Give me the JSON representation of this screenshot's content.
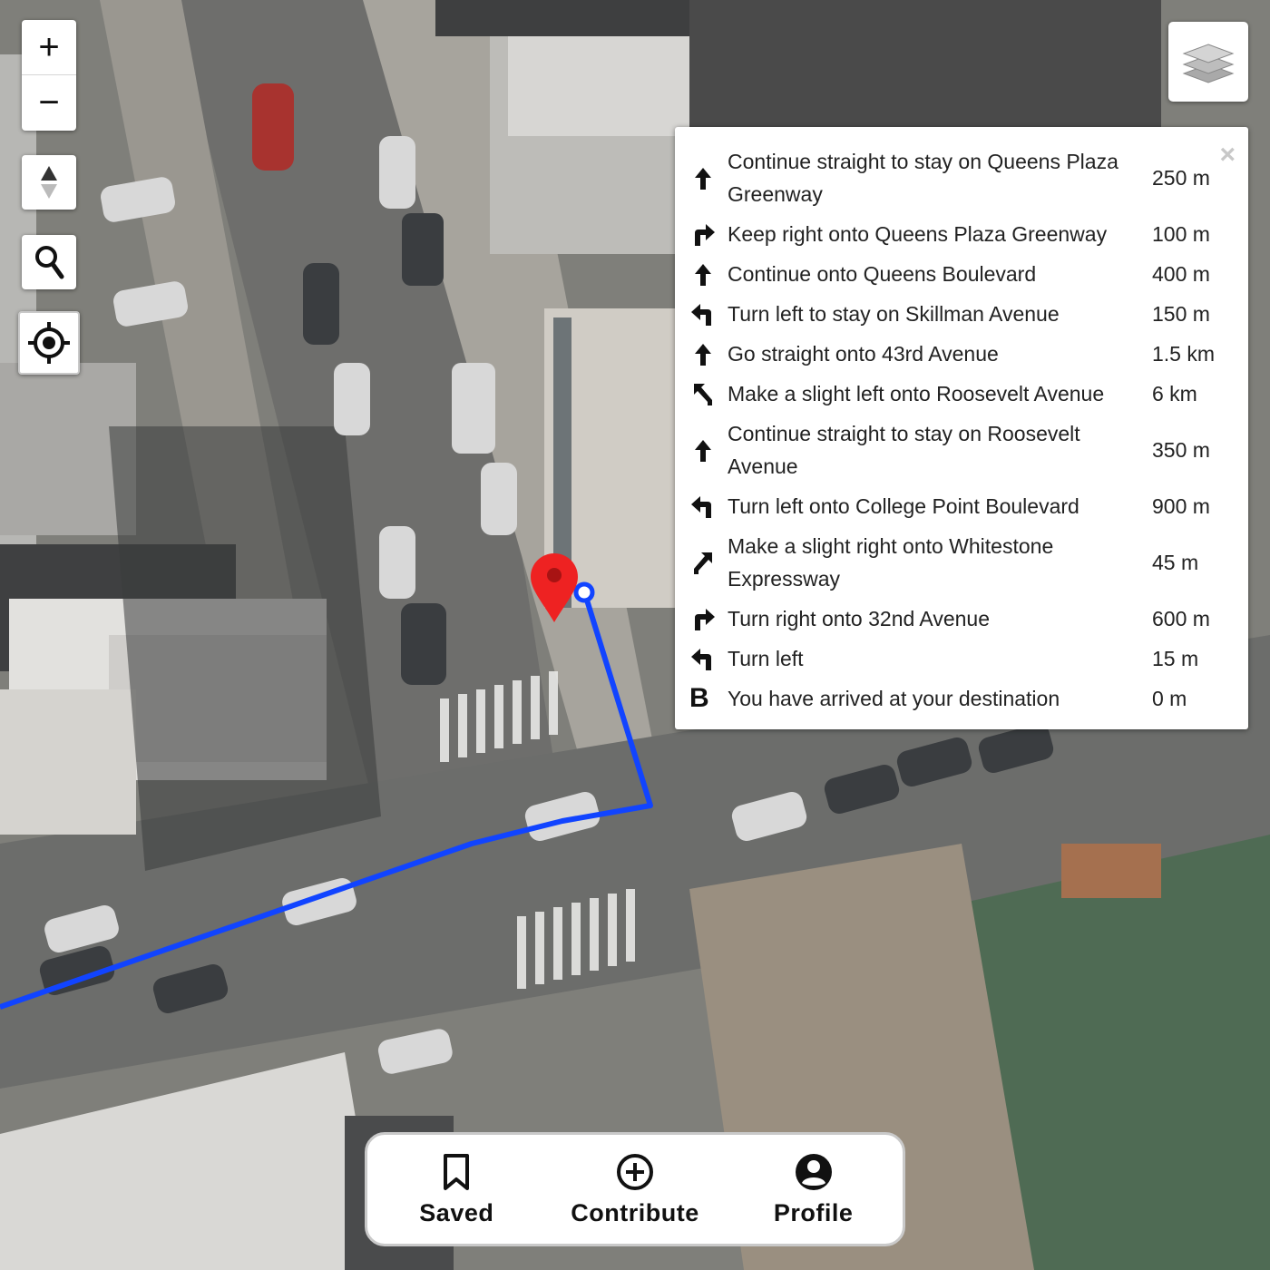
{
  "map": {
    "zoom_in_label": "+",
    "zoom_out_label": "−",
    "route_color": "#1144ff",
    "marker_color": "#ee2222"
  },
  "directions": {
    "close_label": "×",
    "steps": [
      {
        "icon": "straight-arrow-icon",
        "text": "Continue straight to stay on Queens Plaza Greenway",
        "distance": "250 m"
      },
      {
        "icon": "turn-right-icon",
        "text": "Keep right onto Queens Plaza Greenway",
        "distance": "100 m"
      },
      {
        "icon": "straight-arrow-icon",
        "text": "Continue onto Queens Boulevard",
        "distance": "400 m"
      },
      {
        "icon": "turn-left-icon",
        "text": "Turn left to stay on Skillman Avenue",
        "distance": "150 m"
      },
      {
        "icon": "straight-arrow-icon",
        "text": "Go straight onto 43rd Avenue",
        "distance": "1.5 km"
      },
      {
        "icon": "slight-left-icon",
        "text": "Make a slight left onto Roosevelt Avenue",
        "distance": "6 km"
      },
      {
        "icon": "straight-arrow-icon",
        "text": "Continue straight to stay on Roosevelt Avenue",
        "distance": "350 m"
      },
      {
        "icon": "turn-left-icon",
        "text": "Turn left onto College Point Boulevard",
        "distance": "900 m"
      },
      {
        "icon": "slight-right-icon",
        "text": "Make a slight right onto Whitestone Expressway",
        "distance": "45 m"
      },
      {
        "icon": "turn-right-icon",
        "text": "Turn right onto 32nd Avenue",
        "distance": "600 m"
      },
      {
        "icon": "turn-left-icon",
        "text": "Turn left",
        "distance": "15 m"
      },
      {
        "icon": "destination-b-icon",
        "text": "You have arrived at your destination",
        "distance": "0 m",
        "letter": "B"
      }
    ]
  },
  "bottom_nav": {
    "saved_label": "Saved",
    "contribute_label": "Contribute",
    "profile_label": "Profile"
  }
}
